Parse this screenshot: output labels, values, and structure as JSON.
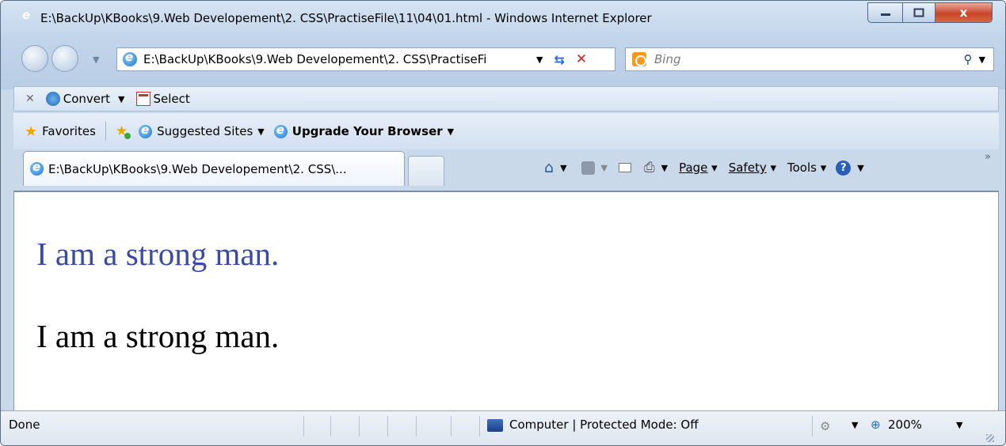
{
  "window": {
    "title": "E:\\BackUp\\KBooks\\9.Web Developement\\2. CSS\\PractiseFile\\11\\04\\01.html - Windows Internet Explorer",
    "close_label": "x"
  },
  "address_bar": {
    "url": "E:\\BackUp\\KBooks\\9.Web Developement\\2. CSS\\PractiseFi"
  },
  "search": {
    "placeholder": "Bing"
  },
  "toolbar": {
    "convert_label": "Convert",
    "select_label": "Select"
  },
  "favorites_bar": {
    "favorites_label": "Favorites",
    "suggested_sites_label": "Suggested Sites",
    "upgrade_label": "Upgrade Your Browser"
  },
  "tabs": [
    {
      "label": "E:\\BackUp\\KBooks\\9.Web Developement\\2. CSS\\..."
    }
  ],
  "command_bar": {
    "page": "Page",
    "safety": "Safety",
    "tools": "Tools"
  },
  "content": {
    "lines": [
      {
        "text": "I am a strong man.",
        "color": "#3a4aa6"
      },
      {
        "text": "I am a strong man.",
        "color": "#000000"
      }
    ]
  },
  "status_bar": {
    "status": "Done",
    "zone": "Computer | Protected Mode: Off",
    "zoom": "200%"
  }
}
